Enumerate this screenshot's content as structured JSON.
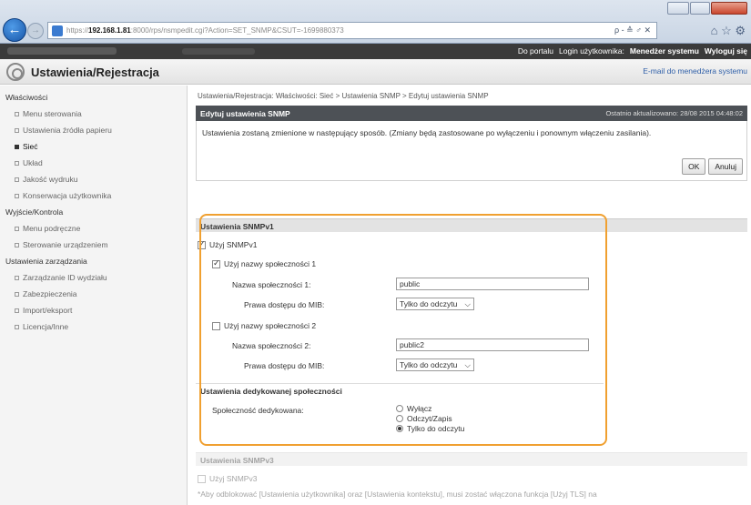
{
  "browser": {
    "url_prefix": "https://",
    "url_host": "192.168.1.81",
    "url_rest": ":8000/rps/nsmpedit.cgi?Action=SET_SNMP&CSUT=-1699880373",
    "addr_tools": "ρ - ≙ ♂ ✕",
    "right_icons": "⌂ ☆ ⚙"
  },
  "topbar": {
    "portal": "Do portalu",
    "login": "Login użytkownika:",
    "user": "Menedżer systemu",
    "logout": "Wyloguj się"
  },
  "header": {
    "title": "Ustawienia/Rejestracja",
    "mail": "E-mail do menedżera systemu"
  },
  "sidebar": {
    "groups": [
      {
        "title": "Właściwości",
        "items": [
          "Menu sterowania",
          "Ustawienia źródła papieru",
          "Sieć",
          "Układ",
          "Jakość wydruku",
          "Konserwacja użytkownika"
        ]
      },
      {
        "title": "Wyjście/Kontrola",
        "items": [
          "Menu podręczne",
          "Sterowanie urządzeniem"
        ]
      },
      {
        "title": "Ustawienia zarządzania",
        "items": [
          "Zarządzanie ID wydziału",
          "Zabezpieczenia",
          "Import/eksport",
          "Licencja/Inne"
        ]
      }
    ],
    "active": "Sieć"
  },
  "main": {
    "breadcrumb": "Ustawienia/Rejestracja: Właściwości: Sieć > Ustawienia SNMP > Edytuj ustawienia SNMP",
    "panel_title": "Edytuj ustawienia SNMP",
    "updated": "Ostatnio aktualizowano: 28/08 2015 04:48:02",
    "message": "Ustawienia zostaną zmienione w następujący sposób. (Zmiany będą zastosowane po wyłączeniu i ponownym włączeniu zasilania).",
    "ok": "OK",
    "cancel": "Anuluj",
    "snmpv1": {
      "heading": "Ustawienia SNMPv1",
      "use": "Użyj SNMPv1",
      "use_name1": "Użyj nazwy społeczności 1",
      "name1_label": "Nazwa społeczności 1:",
      "name1_value": "public",
      "mib1_label": "Prawa dostępu do MIB:",
      "mib1_value": "Tylko do odczytu",
      "use_name2": "Użyj nazwy społeczności 2",
      "name2_label": "Nazwa społeczności 2:",
      "name2_value": "public2",
      "mib2_label": "Prawa dostępu do MIB:",
      "mib2_value": "Tylko do odczytu"
    },
    "dedicated": {
      "heading": "Ustawienia dedykowanej społeczności",
      "label": "Społeczność dedykowana:",
      "options": [
        "Wyłącz",
        "Odczyt/Zapis",
        "Tylko do odczytu"
      ],
      "selected": "Tylko do odczytu"
    },
    "snmpv3": {
      "heading": "Ustawienia SNMPv3",
      "use": "Użyj SNMPv3",
      "note": "*Aby odblokować [Ustawienia użytkownika] oraz [Ustawienia kontekstu], musi zostać włączona funkcja [Użyj TLS] na"
    }
  }
}
